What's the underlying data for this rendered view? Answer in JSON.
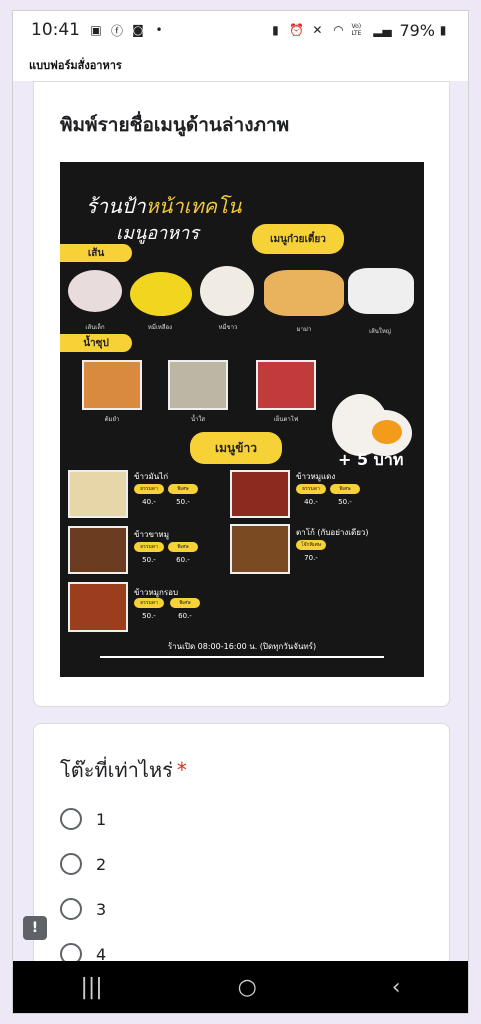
{
  "status_bar": {
    "time": "10:41",
    "battery": "79%",
    "left_icons": [
      "gallery-icon",
      "facebook-icon",
      "robot-icon",
      "dot-icon"
    ],
    "right_icons": [
      "battery-saver-icon",
      "alarm-icon",
      "mute-icon",
      "wifi-icon",
      "volte-icon",
      "signal-icon",
      "battery-icon"
    ],
    "volte": "Vo) LTE"
  },
  "app_header": {
    "title": "แบบฟอร์มสั่งอาหาร"
  },
  "question1": {
    "title": "พิมพ์รายชื่อเมนูด้านล่างภาพ"
  },
  "menu_image": {
    "shop_name_prefix": "ร้านป้า",
    "shop_name_highlight": "หน้าเทคโน",
    "subtitle": "เมนูอาหาร",
    "noodle_tag": "เมนูก๋วยเตี๋ยว",
    "section_noodle": "เส้น",
    "noodles": [
      "เส้นเล็ก",
      "หมี่เหลือง",
      "หมี่ขาว",
      "มาม่า",
      "เส้นใหญ่"
    ],
    "section_soup": "น้ำซุป",
    "soups": [
      "ต้มยำ",
      "น้ำใส",
      "เย็นตาโฟ"
    ],
    "rice_tag": "เมนูข้าว",
    "egg_price": "+ 5 บาท",
    "dishes": [
      {
        "name": "ข้าวมันไก่",
        "sizes": [
          "ธรรมดา",
          "พิเศษ"
        ],
        "prices": [
          "40.-",
          "50.-"
        ]
      },
      {
        "name": "ข้าวหมูแดง",
        "sizes": [
          "ธรรมดา",
          "พิเศษ"
        ],
        "prices": [
          "40.-",
          "50.-"
        ]
      },
      {
        "name": "ข้าวขาหมู",
        "sizes": [
          "ธรรมดา",
          "พิเศษ"
        ],
        "prices": [
          "50.-",
          "60.-"
        ]
      },
      {
        "name": "ตาโก้ (กับอย่างเดียว)",
        "sizes": [
          "โจ๊กพิเศษ"
        ],
        "prices": [
          "70.-"
        ]
      },
      {
        "name": "ข้าวหมูกรอบ",
        "sizes": [
          "ธรรมดา",
          "พิเศษ"
        ],
        "prices": [
          "50.-",
          "60.-"
        ]
      }
    ],
    "open_hours": "ร้านเปิด 08:00-16:00 น. (ปิดทุกวันจันทร์)"
  },
  "question2": {
    "title": "โต๊ะที่เท่าไหร่",
    "required_mark": "*",
    "options": [
      "1",
      "2",
      "3",
      "4"
    ]
  },
  "feedback": {
    "icon": "feedback-icon",
    "glyph": "!"
  },
  "nav_bar": {
    "recents": "|||",
    "home": "○",
    "back": "‹"
  },
  "colors": {
    "accent": "#f7d237",
    "required": "#d93025",
    "background": "#efeaf7"
  }
}
